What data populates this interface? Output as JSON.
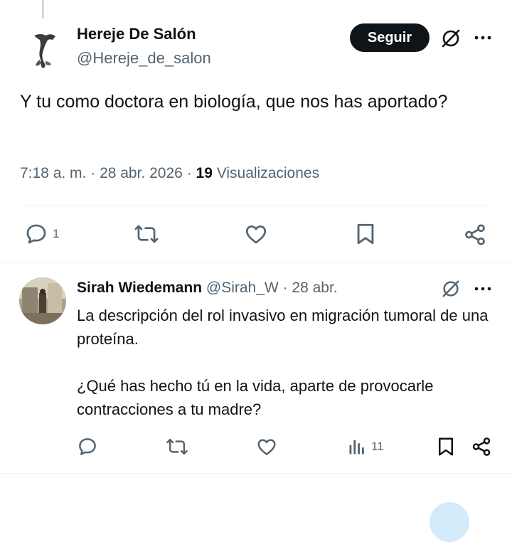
{
  "main_tweet": {
    "author_name": "Hereje De Salón",
    "author_handle": "@Hereje_de_salon",
    "follow_label": "Seguir",
    "text": "Y tu como doctora en biología, que nos has aportado?",
    "time": "7:18 a. m.",
    "date": "28 abr. 2026",
    "views_count": "19",
    "views_label": "Visualizaciones",
    "actions": {
      "reply_count": "1",
      "reply_icon": "reply-icon",
      "retweet_icon": "retweet-icon",
      "like_icon": "heart-icon",
      "bookmark_icon": "bookmark-icon",
      "share_icon": "share-icon"
    }
  },
  "reply": {
    "author_name": "Sirah Wiedemann",
    "author_handle": "@Sirah_W",
    "date": "28 abr.",
    "paragraphs": [
      "La descripción del rol invasivo en migración tumoral de una proteína.",
      "¿Qué has hecho tú en la vida, aparte de provocarle contracciones a tu madre?"
    ],
    "actions": {
      "views_count": "11",
      "views_icon": "analytics-icon"
    }
  },
  "colors": {
    "text": "#0f1419",
    "secondary": "#536471",
    "divider": "#eff3f4",
    "button_bg": "#0f1419",
    "fab": "#d4ebfb"
  }
}
